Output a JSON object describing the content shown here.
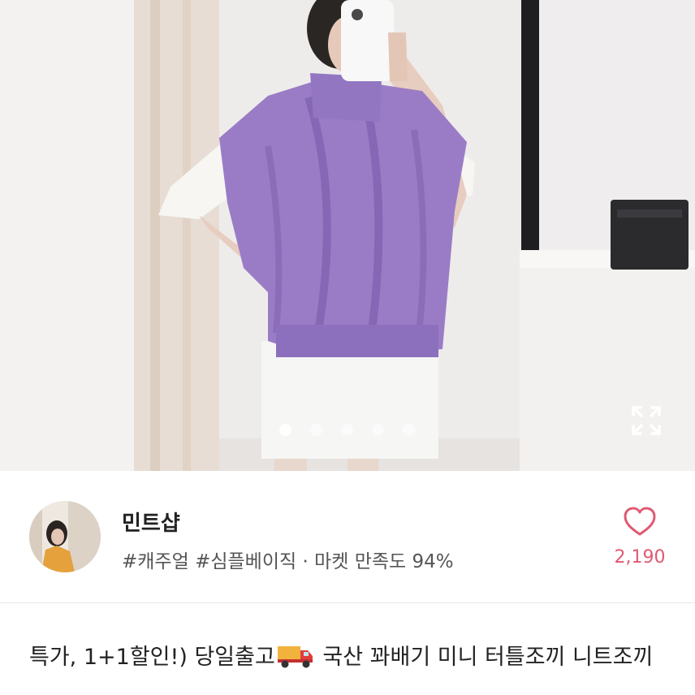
{
  "product_image": {
    "description_icon": "product-photo",
    "carousel": {
      "count": 5,
      "active_index": 0
    },
    "expand_icon": "expand-arrows-icon"
  },
  "shop": {
    "name": "민트샵",
    "tags": "#캐주얼 #심플베이직 · 마켓 만족도 94%",
    "like_icon": "heart-outline-icon",
    "like_count": "2,190",
    "like_color": "#e05a72"
  },
  "product": {
    "title_part1": "특가, 1+1할인!) 당일출고",
    "title_icon": "delivery-truck-icon",
    "title_part2": " 국산 꽈배기 미니 터틀조끼 니트조끼"
  }
}
